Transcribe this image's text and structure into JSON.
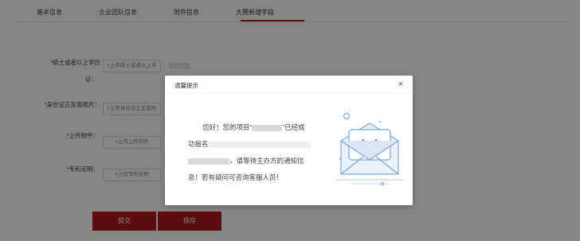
{
  "tabs": [
    {
      "label": "基本信息"
    },
    {
      "label": "企业团队信息"
    },
    {
      "label": "附件信息"
    },
    {
      "label": "大赛新增字段"
    }
  ],
  "form": {
    "fields": [
      {
        "label_line1": "硕士或者以上学历",
        "label_line2": "证：",
        "upload_label": "+上传硕士或者以上学"
      },
      {
        "label": "身份证正反面照片：",
        "upload_label": "+上传身份证正反面照"
      },
      {
        "label": "上传附件：",
        "upload_label": "+上传上传附件"
      },
      {
        "label": "专利证明：",
        "upload_label": "+上传专利证明"
      }
    ],
    "required_mark": "*",
    "submit_label": "提交",
    "save_label": "保存"
  },
  "dialog": {
    "title": "温馨提示",
    "close_symbol": "×",
    "message_prefix": "您好！您的项目“",
    "message_quote_close": "”已经成",
    "message_line2": "功报名",
    "message_line3": "，请等待主办方的通知信",
    "message_line4": "息！若有疑问可咨询客服人员！",
    "illustration": "envelope-smile-icon"
  },
  "colors": {
    "brand": "#b0161b",
    "overlay": "rgba(0,0,0,0.48)"
  }
}
